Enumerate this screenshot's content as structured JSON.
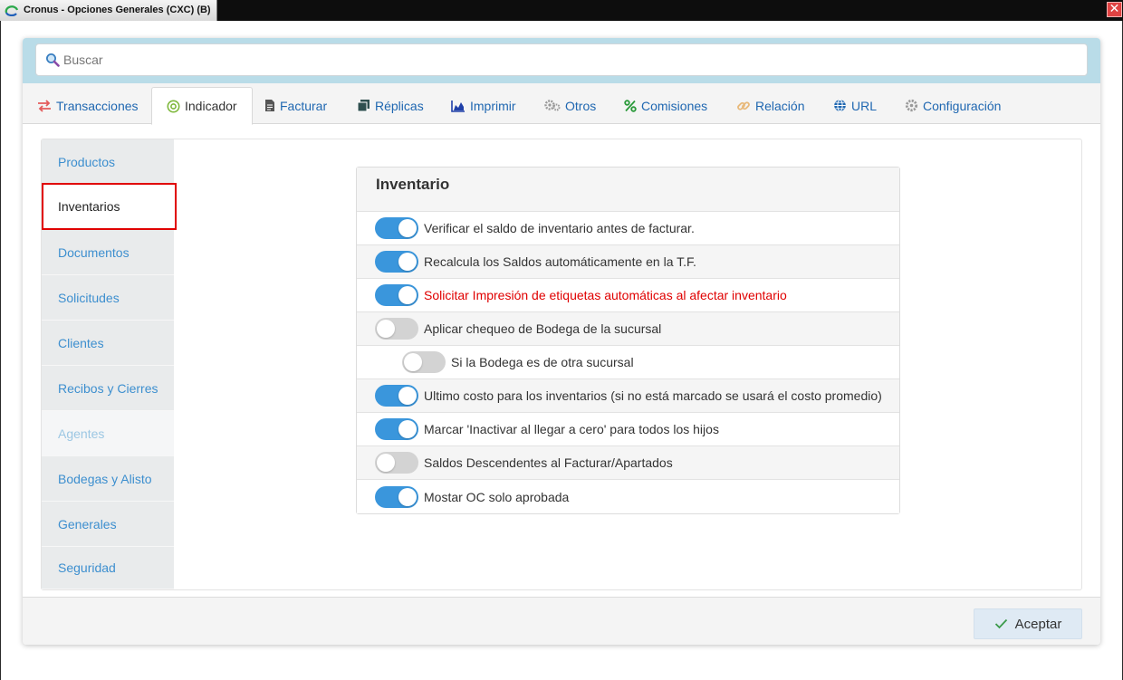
{
  "window": {
    "title": "Cronus - Opciones Generales (CXC) (B)",
    "close_glyph": "✕"
  },
  "search": {
    "placeholder": "Buscar",
    "value": ""
  },
  "tabs": [
    {
      "label": "Transacciones",
      "icon": "exchange-icon",
      "active": false
    },
    {
      "label": "Indicador",
      "icon": "target-icon",
      "active": true
    },
    {
      "label": "Facturar",
      "icon": "document-icon",
      "active": false
    },
    {
      "label": "Réplicas",
      "icon": "copy-icon",
      "active": false
    },
    {
      "label": "Imprimir",
      "icon": "area-chart-icon",
      "active": false
    },
    {
      "label": "Otros",
      "icon": "gears-icon",
      "active": false
    },
    {
      "label": "Comisiones",
      "icon": "percent-icon",
      "active": false
    },
    {
      "label": "Relación",
      "icon": "link-icon",
      "active": false
    },
    {
      "label": "URL",
      "icon": "globe-icon",
      "active": false
    },
    {
      "label": "Configuración",
      "icon": "gear-icon",
      "active": false
    }
  ],
  "sidebar": {
    "items": [
      {
        "label": "Productos",
        "state": "normal"
      },
      {
        "label": "Inventarios",
        "state": "selected"
      },
      {
        "label": "Documentos",
        "state": "normal"
      },
      {
        "label": "Solicitudes",
        "state": "normal"
      },
      {
        "label": "Clientes",
        "state": "normal"
      },
      {
        "label": "Recibos y Cierres",
        "state": "normal"
      },
      {
        "label": "Agentes",
        "state": "disabled"
      },
      {
        "label": "Bodegas y Alisto",
        "state": "normal"
      },
      {
        "label": "Generales",
        "state": "normal"
      },
      {
        "label": "Seguridad",
        "state": "normal"
      }
    ]
  },
  "inventory": {
    "title": "Inventario",
    "options": [
      {
        "label": "Verificar el saldo de inventario antes de facturar.",
        "on": true
      },
      {
        "label": "Recalcula los Saldos automáticamente en la T.F.",
        "on": true
      },
      {
        "label": "Solicitar Impresión de etiquetas automáticas al afectar inventario",
        "on": true
      },
      {
        "label": "Aplicar chequeo de Bodega de la sucursal",
        "on": false
      },
      {
        "label": "Si la Bodega es de otra sucursal",
        "on": false
      },
      {
        "label": "Ultimo costo para los inventarios (si no está marcado se usará el costo promedio)",
        "on": true
      },
      {
        "label": "Marcar 'Inactivar al llegar a cero' para todos los hijos",
        "on": true
      },
      {
        "label": "Saldos Descendentes al Facturar/Apartados",
        "on": false
      },
      {
        "label": "Mostar OC solo aprobada",
        "on": true
      }
    ]
  },
  "footer": {
    "accept_label": "Aceptar"
  },
  "colors": {
    "accent": "#3a96dc",
    "link": "#1f67b1",
    "nav_link": "#3d8fcf",
    "warning_text": "#e00000",
    "selection_border": "#e00000",
    "search_band": "#b9dce8"
  }
}
